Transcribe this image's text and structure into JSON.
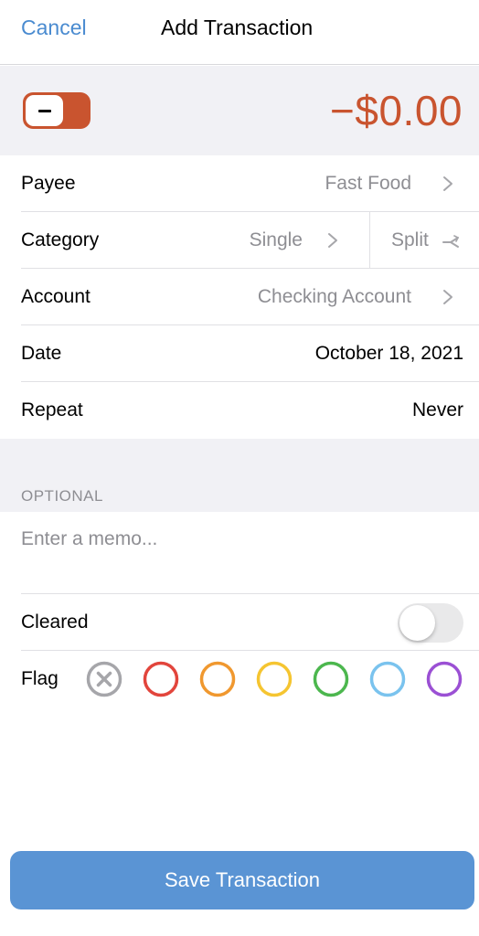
{
  "nav": {
    "cancel": "Cancel",
    "title": "Add Transaction"
  },
  "amount": {
    "sign": "negative",
    "value": "−$0.00",
    "color": "#c9542f"
  },
  "rows": {
    "payee": {
      "label": "Payee",
      "value": "Fast Food"
    },
    "category": {
      "label": "Category",
      "single": "Single",
      "split": "Split"
    },
    "account": {
      "label": "Account",
      "value": "Checking Account"
    },
    "date": {
      "label": "Date",
      "value": "October 18, 2021"
    },
    "repeat": {
      "label": "Repeat",
      "value": "Never"
    }
  },
  "optional": {
    "header": "OPTIONAL",
    "memo_placeholder": "Enter a memo...",
    "memo_value": "",
    "cleared": {
      "label": "Cleared",
      "on": false
    },
    "flag": {
      "label": "Flag",
      "options": [
        {
          "name": "none",
          "color": "#a6a6aa"
        },
        {
          "name": "red",
          "color": "#e2453c"
        },
        {
          "name": "orange",
          "color": "#f0982f"
        },
        {
          "name": "yellow",
          "color": "#f5c531"
        },
        {
          "name": "green",
          "color": "#4cb74e"
        },
        {
          "name": "blue",
          "color": "#7ac3ee"
        },
        {
          "name": "purple",
          "color": "#9b50d4"
        }
      ]
    }
  },
  "save_label": "Save Transaction",
  "colors": {
    "accent": "#4a8bd0",
    "save_button": "#5a94d4",
    "group_background": "#f1f1f5"
  }
}
